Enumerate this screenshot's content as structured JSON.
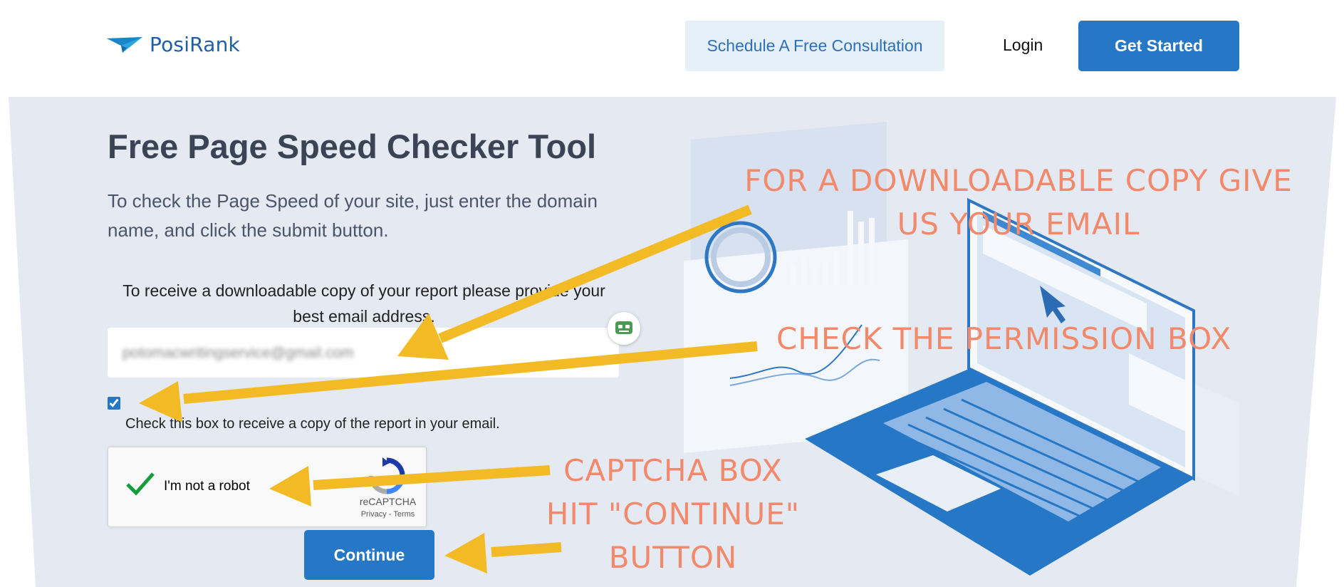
{
  "header": {
    "brand": "PosiRank",
    "consult_label": "Schedule A Free Consultation",
    "login_label": "Login",
    "get_started_label": "Get Started"
  },
  "main": {
    "title": "Free Page Speed Checker Tool",
    "intro": "To check the Page Speed of your site, just enter the domain name, and click the submit button.",
    "email_note": "To receive a downloadable copy of your report please provide your best email address.",
    "email_value": "potomacwritingservice@gmail.com",
    "checkbox_checked": true,
    "checkbox_label": "Check this box to receive a copy of the report in your email.",
    "continue_label": "Continue"
  },
  "recaptcha": {
    "label": "I'm not a robot",
    "brand": "reCAPTCHA",
    "links": "Privacy - Terms"
  },
  "annotations": {
    "email": "FOR A DOWNLOADABLE COPY GIVE US YOUR EMAIL",
    "permission": "CHECK THE PERMISSION BOX",
    "captcha": "CAPTCHA BOX HIT \"CONTINUE\" BUTTON"
  },
  "colors": {
    "brand_blue": "#2678c6",
    "hero_bg": "#e4e9f2",
    "annotation": "#f2896b",
    "arrow": "#f2bb26"
  }
}
